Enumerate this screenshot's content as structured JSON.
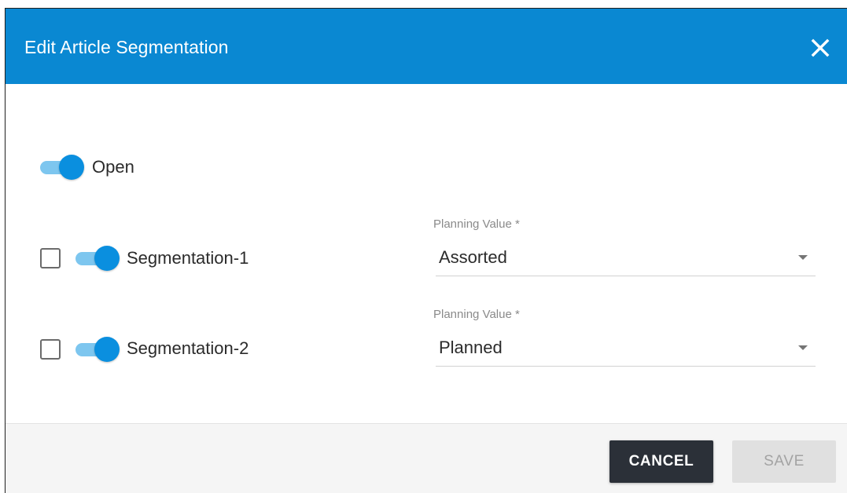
{
  "dialog": {
    "title": "Edit Article Segmentation"
  },
  "open_toggle": {
    "label": "Open",
    "checked": true
  },
  "segments": [
    {
      "label": "Segmentation-1",
      "checked": false,
      "toggle_on": true,
      "field_label": "Planning Value *",
      "value": "Assorted"
    },
    {
      "label": "Segmentation-2",
      "checked": false,
      "toggle_on": true,
      "field_label": "Planning Value *",
      "value": "Planned"
    }
  ],
  "footer": {
    "cancel_label": "CANCEL",
    "save_label": "SAVE"
  },
  "colors": {
    "header": "#0a88d2",
    "toggle_thumb": "#0a8fdf",
    "toggle_track": "#7dc6ef",
    "cancel_bg": "#2b3038"
  }
}
